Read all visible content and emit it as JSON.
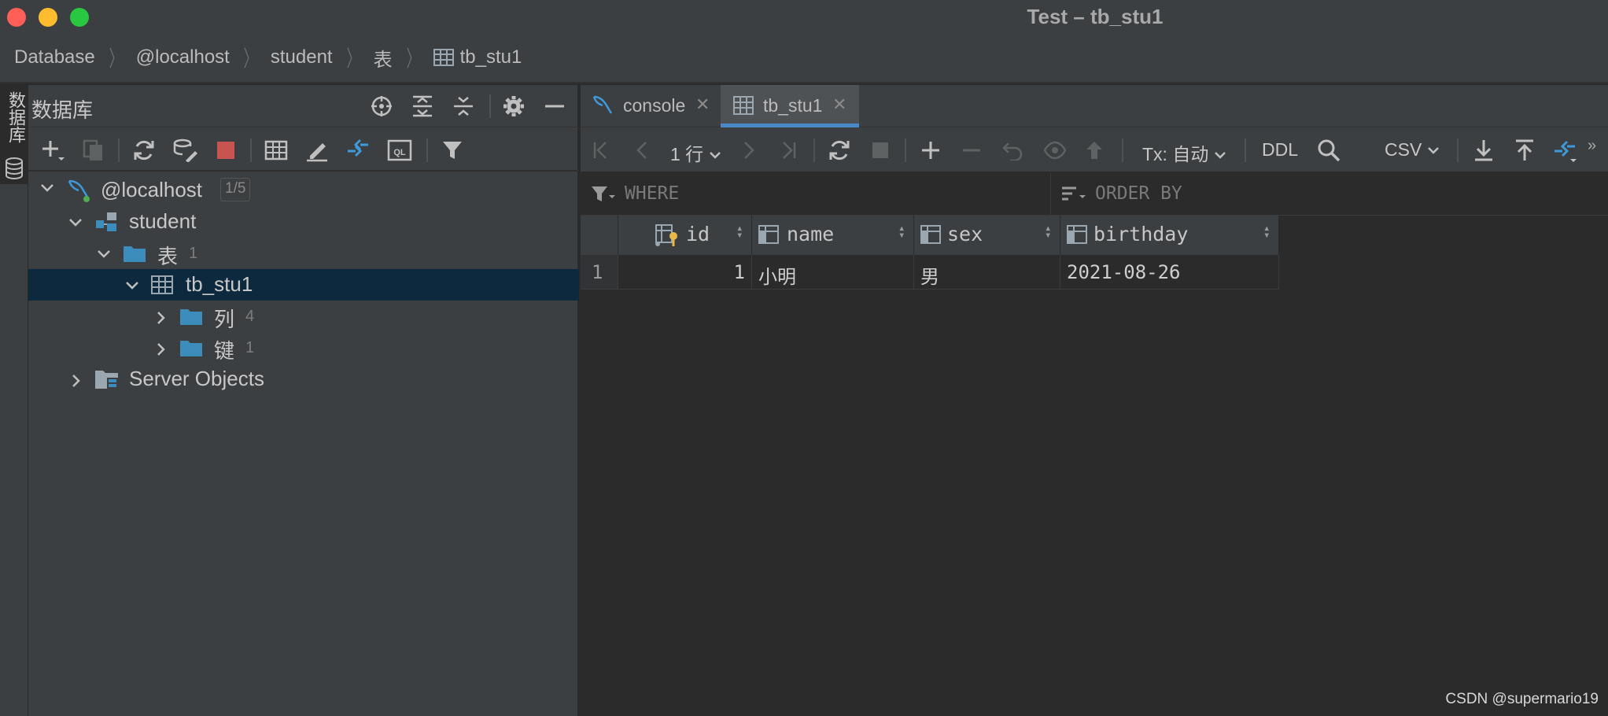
{
  "window": {
    "title": "Test – tb_stu1",
    "traffic_lights": [
      "#ff5f57",
      "#febc2e",
      "#28c840"
    ]
  },
  "breadcrumb": [
    "Database",
    "@localhost",
    "student",
    "表",
    "tb_stu1"
  ],
  "toolstrip": {
    "label": "数据库"
  },
  "db_panel": {
    "title": "数据库",
    "tree": {
      "host": {
        "label": "@localhost",
        "badge": "1/5"
      },
      "schema": {
        "label": "student"
      },
      "tables_folder": {
        "label": "表",
        "count": "1"
      },
      "table": {
        "label": "tb_stu1"
      },
      "columns_folder": {
        "label": "列",
        "count": "4"
      },
      "keys_folder": {
        "label": "键",
        "count": "1"
      },
      "server_objects": {
        "label": "Server Objects"
      }
    }
  },
  "tabs": [
    {
      "label": "console",
      "active": false
    },
    {
      "label": "tb_stu1",
      "active": true
    }
  ],
  "grid_toolbar": {
    "rows_label": "1 行",
    "tx_label": "Tx: 自动",
    "ddl_label": "DDL",
    "export_format": "CSV"
  },
  "filter": {
    "where_placeholder": "WHERE",
    "order_placeholder": "ORDER BY"
  },
  "table": {
    "columns": [
      "id",
      "name",
      "sex",
      "birthday"
    ],
    "rows": [
      {
        "num": "1",
        "cells": [
          "1",
          "小明",
          "男",
          "2021-08-26"
        ]
      }
    ]
  },
  "watermark": "CSDN @supermario19",
  "colors": {
    "accent": "#4a88c7",
    "selection": "#0d293e",
    "folder": "#3c8dbc",
    "stop": "#c75450",
    "key": "#e8b94a"
  }
}
